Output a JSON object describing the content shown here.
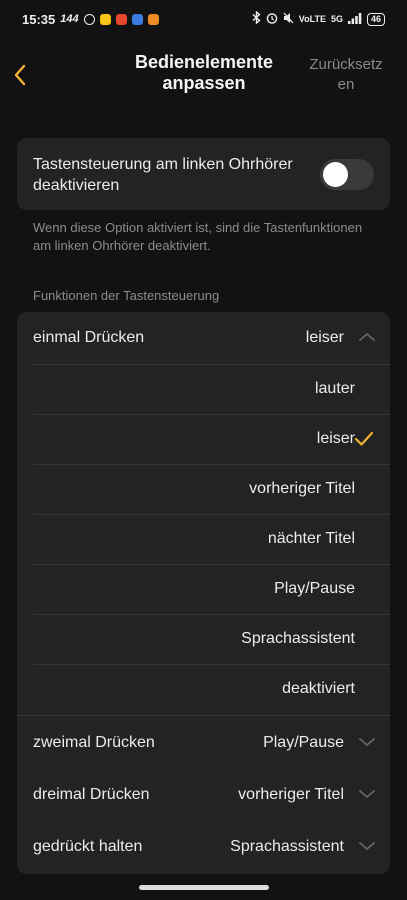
{
  "status_bar": {
    "time": "15:35",
    "refresh_rate": "144",
    "network": "VoLTE",
    "signal": "5G",
    "battery": "46",
    "app_colors": [
      "#f5c518",
      "#e8452f",
      "#3a7be0",
      "#f08a24"
    ]
  },
  "header": {
    "back_icon": "chevron-left-icon",
    "title": "Bedienelemente anpassen",
    "reset": "Zurücksetz en"
  },
  "toggle": {
    "label": "Tastensteuerung am linken Ohrhörer deaktivieren",
    "enabled": false,
    "hint": "Wenn diese Option aktiviert ist, sind die Tastenfunktionen am linken Ohrhörer deaktiviert."
  },
  "section": {
    "label": "Funktionen der Tastensteuerung"
  },
  "controls": [
    {
      "label": "einmal Drücken",
      "value": "leiser",
      "expanded": true
    },
    {
      "label": "zweimal Drücken",
      "value": "Play/Pause",
      "expanded": false
    },
    {
      "label": "dreimal Drücken",
      "value": "vorheriger Titel",
      "expanded": false
    },
    {
      "label": "gedrückt halten",
      "value": "Sprachassistent",
      "expanded": false
    }
  ],
  "options": [
    "lauter",
    "leiser",
    "vorheriger Titel",
    "nächter Titel",
    "Play/Pause",
    "Sprachassistent",
    "deaktiviert"
  ],
  "selected_option": "leiser",
  "accent_color": "#f2b233"
}
